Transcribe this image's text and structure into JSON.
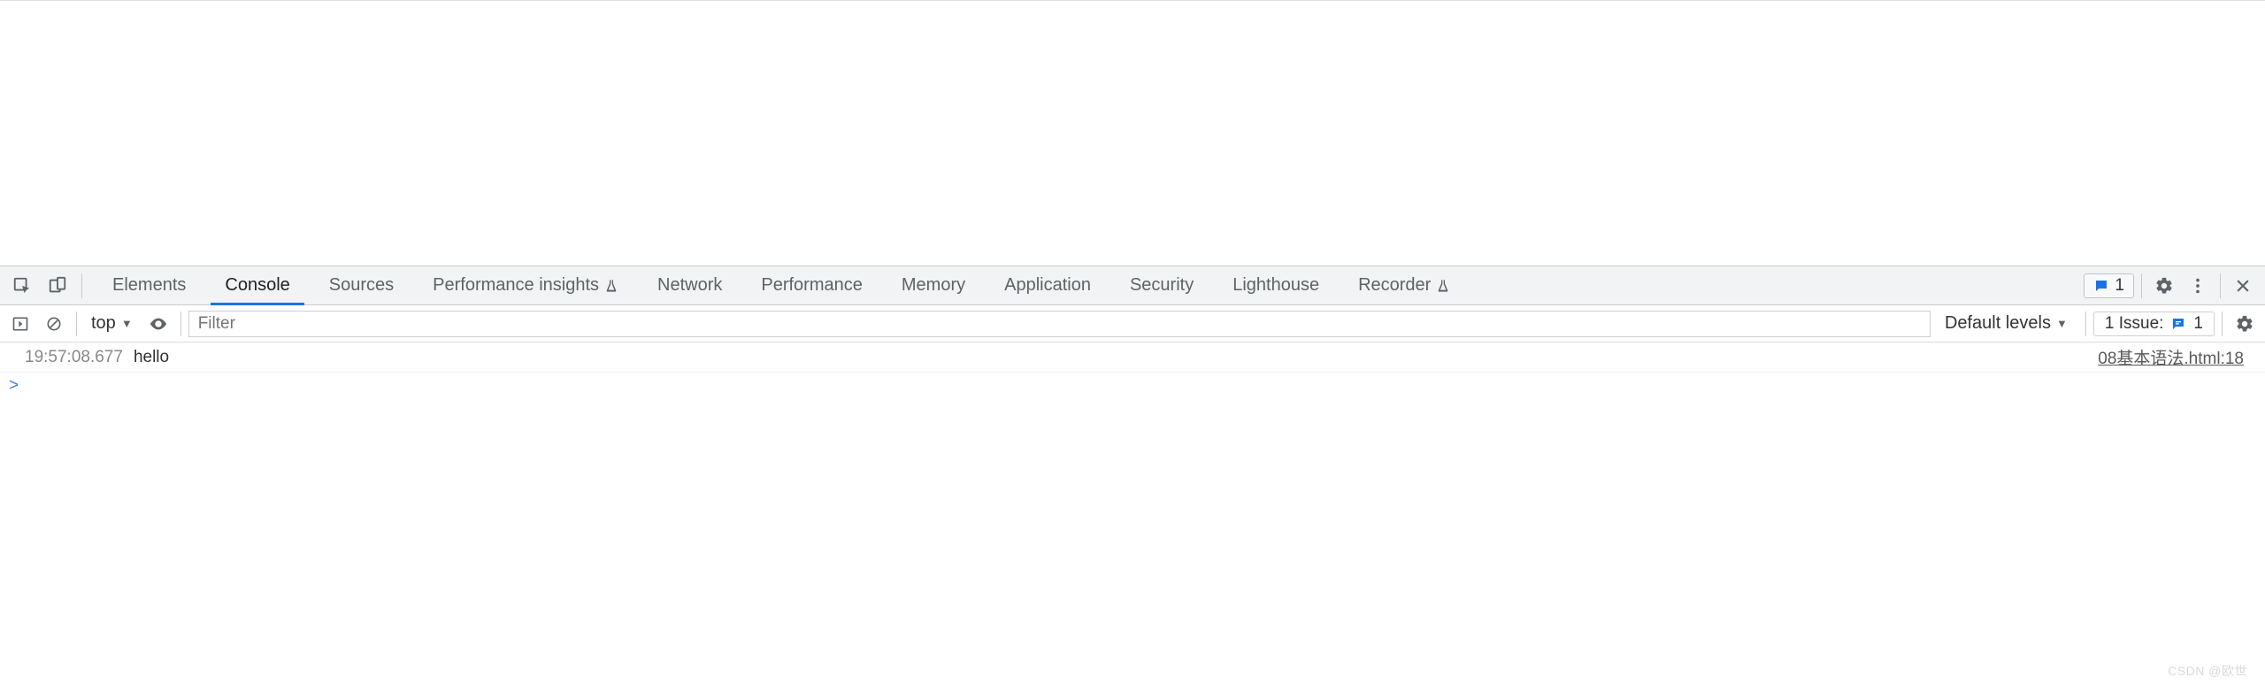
{
  "tabs": {
    "items": [
      {
        "label": "Elements",
        "active": false,
        "flask": false
      },
      {
        "label": "Console",
        "active": true,
        "flask": false
      },
      {
        "label": "Sources",
        "active": false,
        "flask": false
      },
      {
        "label": "Performance insights",
        "active": false,
        "flask": true
      },
      {
        "label": "Network",
        "active": false,
        "flask": false
      },
      {
        "label": "Performance",
        "active": false,
        "flask": false
      },
      {
        "label": "Memory",
        "active": false,
        "flask": false
      },
      {
        "label": "Application",
        "active": false,
        "flask": false
      },
      {
        "label": "Security",
        "active": false,
        "flask": false
      },
      {
        "label": "Lighthouse",
        "active": false,
        "flask": false
      },
      {
        "label": "Recorder",
        "active": false,
        "flask": true
      }
    ],
    "badge_count": "1"
  },
  "toolbar": {
    "context": "top",
    "filter_placeholder": "Filter",
    "levels_label": "Default levels",
    "issues_label": "1 Issue:",
    "issues_count": "1"
  },
  "log": {
    "timestamp": "19:57:08.677",
    "message": "hello",
    "source": "08基本语法.html:18"
  },
  "prompt": ">",
  "watermark": "CSDN @欧世"
}
